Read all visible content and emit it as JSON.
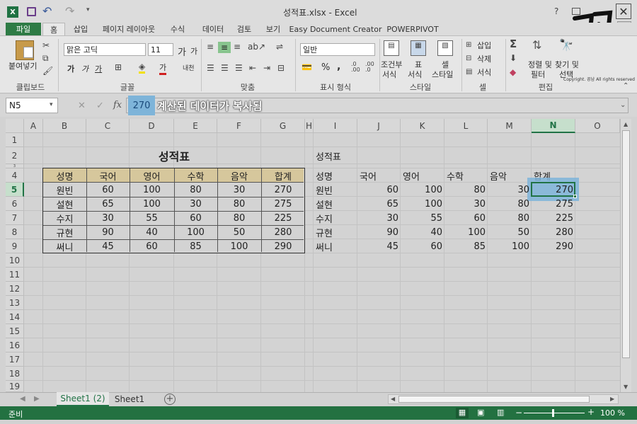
{
  "app": {
    "title": "성적표.xlsx - Excel",
    "help": "?",
    "user_fragment": "인",
    "watermark_copyright": "Copyright. 꽁남 All rights reserved"
  },
  "qat": {
    "undo": "↶",
    "redo": "↷"
  },
  "tabs": [
    "파일",
    "홈",
    "삽입",
    "페이지 레이아웃",
    "수식",
    "데이터",
    "검토",
    "보기",
    "Easy Document Creator",
    "POWERPIVOT"
  ],
  "ribbon": {
    "clipboard": {
      "paste": "붙여넣기",
      "group": "클립보드"
    },
    "font": {
      "name": "맑은 고딕",
      "size": "11",
      "grow": "가",
      "shrink": "가",
      "bold": "가",
      "italic": "가",
      "underline": "가",
      "phonetic": "내천",
      "group": "글꼴"
    },
    "align": {
      "group": "맞춤"
    },
    "number": {
      "format": "일반",
      "percent": "%",
      "comma": ",",
      "group": "표시 형식"
    },
    "styles": {
      "conditional_top": "조건부",
      "conditional_bottom": "서식",
      "table_top": "표",
      "table_bottom": "서식",
      "cell_top": "셀",
      "cell_bottom": "스타일",
      "group": "스타일"
    },
    "cells": {
      "insert": "삽입",
      "delete": "삭제",
      "format": "서식",
      "group": "셀"
    },
    "edit": {
      "sort_top": "정렬 및",
      "sort_bottom": "필터",
      "find_top": "찾기 및",
      "find_bottom": "선택",
      "group": "편집"
    }
  },
  "formula_bar": {
    "name_box": "N5",
    "cancel": "✕",
    "enter": "✓",
    "fx": "fx",
    "value": "270",
    "annotation": "계산된 데이터가 복사됨"
  },
  "columns": [
    "A",
    "B",
    "C",
    "D",
    "E",
    "F",
    "G",
    "H",
    "I",
    "J",
    "K",
    "L",
    "M",
    "N",
    "O"
  ],
  "rows": [
    "1",
    "2",
    "3",
    "4",
    "5",
    "6",
    "7",
    "8",
    "9",
    "10",
    "11",
    "12",
    "13",
    "14",
    "15",
    "16",
    "17",
    "18",
    "19"
  ],
  "left_table": {
    "title": "성적표",
    "headers": [
      "성명",
      "국어",
      "영어",
      "수학",
      "음악",
      "합계"
    ],
    "rows": [
      [
        "원빈",
        "60",
        "100",
        "80",
        "30",
        "270"
      ],
      [
        "설현",
        "65",
        "100",
        "30",
        "80",
        "275"
      ],
      [
        "수지",
        "30",
        "55",
        "60",
        "80",
        "225"
      ],
      [
        "규현",
        "90",
        "40",
        "100",
        "50",
        "280"
      ],
      [
        "써니",
        "45",
        "60",
        "85",
        "100",
        "290"
      ]
    ]
  },
  "right_table": {
    "title": "성적표",
    "headers": [
      "성명",
      "국어",
      "영어",
      "수학",
      "음악",
      "합계"
    ],
    "rows": [
      [
        "원빈",
        "60",
        "100",
        "80",
        "30",
        "270"
      ],
      [
        "설현",
        "65",
        "100",
        "30",
        "80",
        "275"
      ],
      [
        "수지",
        "30",
        "55",
        "60",
        "80",
        "225"
      ],
      [
        "규현",
        "90",
        "40",
        "100",
        "50",
        "280"
      ],
      [
        "써니",
        "45",
        "60",
        "85",
        "100",
        "290"
      ]
    ]
  },
  "sheet_tabs": [
    "Sheet1 (2)",
    "Sheet1"
  ],
  "status": {
    "ready": "준비",
    "zoom": "100 %",
    "minus": "−",
    "plus": "+"
  },
  "colors": {
    "excel_green": "#237141",
    "header_fill": "#d6c79c",
    "highlight": "#7eb4d9"
  }
}
